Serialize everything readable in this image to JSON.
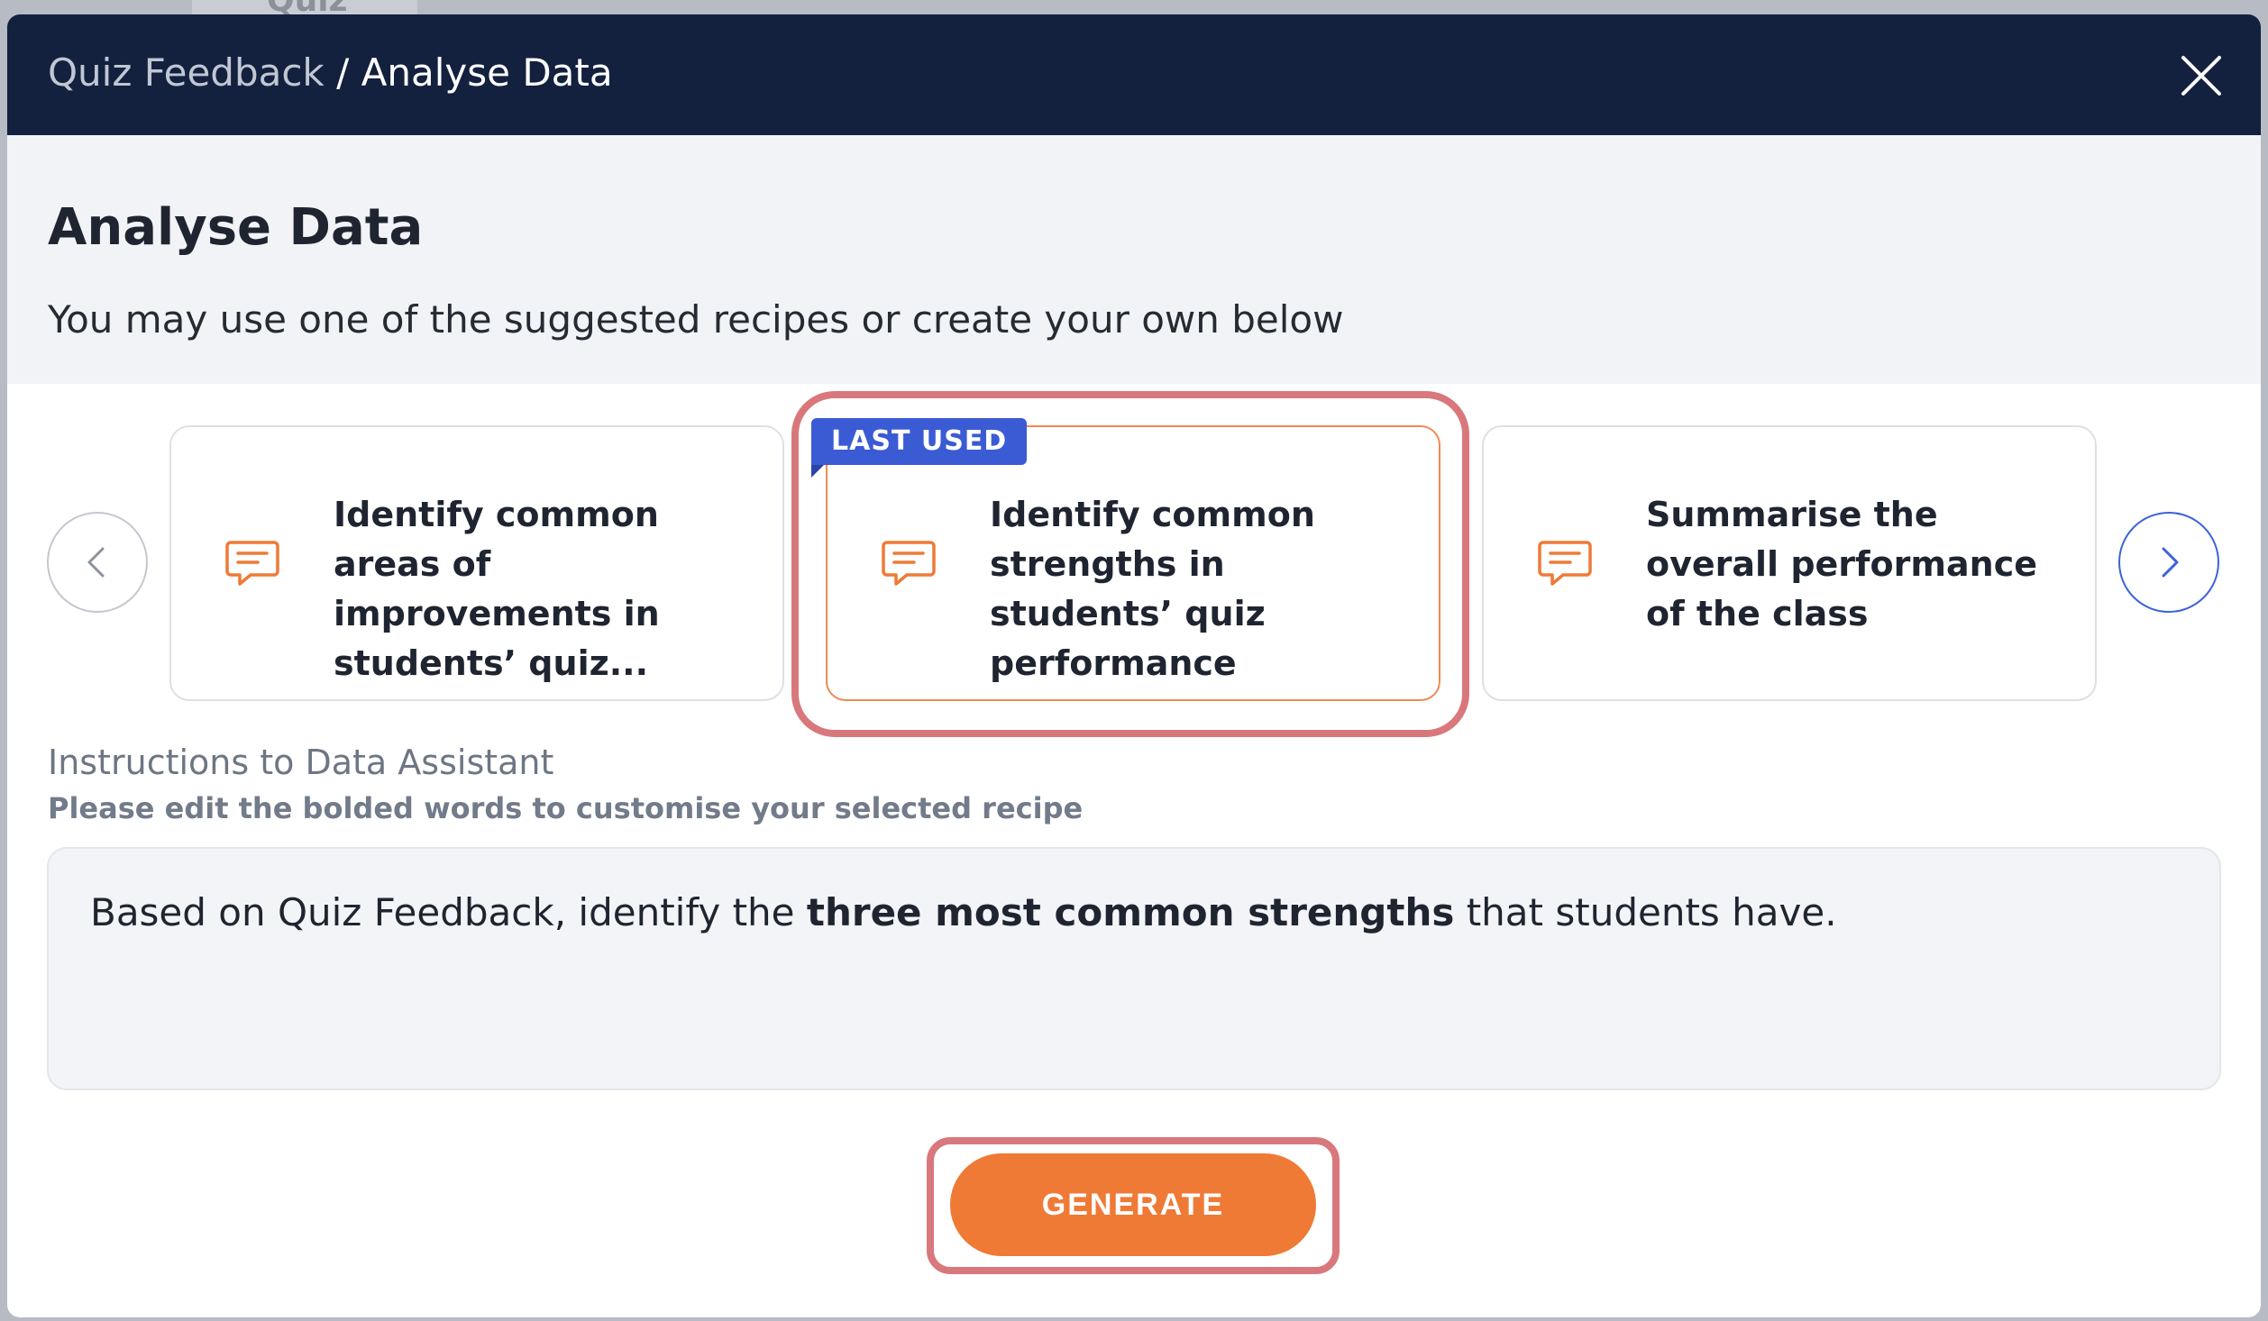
{
  "backdrop": {
    "tab_label": "Quiz"
  },
  "header": {
    "breadcrumb_parent": "Quiz Feedback",
    "breadcrumb_separator": "/",
    "breadcrumb_current": "Analyse Data",
    "close_icon": "close-icon"
  },
  "intro": {
    "title": "Analyse Data",
    "description": "You may use one of the suggested recipes or create your own below"
  },
  "recipes": {
    "prev_icon": "chevron-left-icon",
    "next_icon": "chevron-right-icon",
    "badge": "LAST USED",
    "items": [
      {
        "label": "Identify common areas of improvements in students’ quiz...",
        "icon": "comment-icon",
        "selected": false
      },
      {
        "label": "Identify common strengths in students’ quiz performance",
        "icon": "comment-icon",
        "selected": true
      },
      {
        "label": "Summarise the overall performance of the class",
        "icon": "comment-icon",
        "selected": false
      }
    ]
  },
  "instructions": {
    "title": "Instructions to Data Assistant",
    "subtitle": "Please edit the bolded words to customise your selected recipe",
    "prompt_prefix": "Based on Quiz Feedback, identify the ",
    "prompt_bold": "three most common strengths",
    "prompt_suffix": " that students have."
  },
  "actions": {
    "generate_label": "GENERATE"
  },
  "colors": {
    "header_bg": "#13213f",
    "accent_orange": "#ef7a36",
    "badge_blue": "#3b5bd5",
    "highlight": "#d9787c"
  }
}
